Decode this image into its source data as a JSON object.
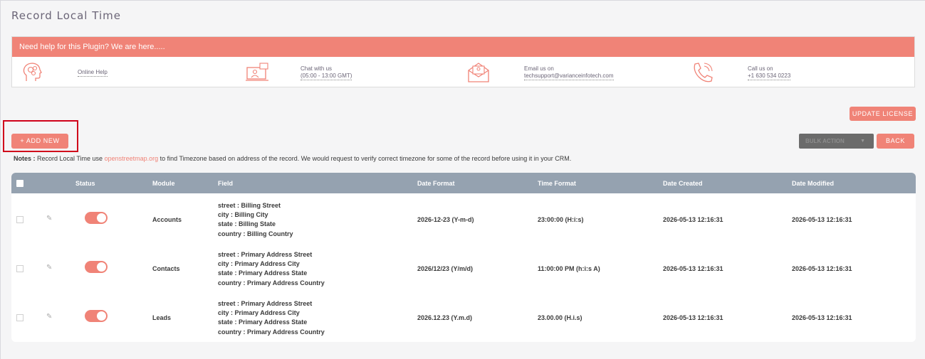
{
  "page": {
    "title": "Record Local Time"
  },
  "help": {
    "banner": "Need help for this Plugin? We are here.....",
    "items": [
      {
        "icon": "brain-head-icon",
        "lines": [
          "Online Help"
        ]
      },
      {
        "icon": "monitor-chat-icon",
        "lines": [
          "Chat with us",
          "(05:00 - 13:00 GMT)"
        ]
      },
      {
        "icon": "envelope-icon",
        "lines": [
          "Email us on",
          "techsupport@varianceinfotech.com"
        ]
      },
      {
        "icon": "phone-icon",
        "lines": [
          "Call us on",
          "+1 630 534 0223"
        ]
      }
    ]
  },
  "toolbar": {
    "update_license": "UPDATE LICENSE",
    "add_new": "+ ADD NEW",
    "bulk_action": "BULK ACTION",
    "back": "BACK"
  },
  "notes": {
    "label": "Notes :",
    "prefix": " Record Local Time use ",
    "link": "openstreetmap.org",
    "suffix": " to find Timezone based on address of the record. We would request to verify correct timezone for some of the record before using it in your CRM."
  },
  "table": {
    "headers": [
      "Status",
      "Module",
      "Field",
      "Date Format",
      "Time Format",
      "Date Created",
      "Date Modified"
    ],
    "rows": [
      {
        "module": "Accounts",
        "fields": [
          {
            "key": "street",
            "val": "Billing Street"
          },
          {
            "key": "city",
            "val": "Billing City"
          },
          {
            "key": "state",
            "val": "Billing State"
          },
          {
            "key": "country",
            "val": "Billing Country"
          }
        ],
        "date_format": "2026-12-23 (Y-m-d)",
        "time_format": "23:00:00 (H:i:s)",
        "date_created": "2026-05-13 12:16:31",
        "date_modified": "2026-05-13 12:16:31"
      },
      {
        "module": "Contacts",
        "fields": [
          {
            "key": "street",
            "val": "Primary Address Street"
          },
          {
            "key": "city",
            "val": "Primary Address City"
          },
          {
            "key": "state",
            "val": "Primary Address State"
          },
          {
            "key": "country",
            "val": "Primary Address Country"
          }
        ],
        "date_format": "2026/12/23 (Y/m/d)",
        "time_format": "11:00:00 PM (h:i:s A)",
        "date_created": "2026-05-13 12:16:31",
        "date_modified": "2026-05-13 12:16:31"
      },
      {
        "module": "Leads",
        "fields": [
          {
            "key": "street",
            "val": "Primary Address Street"
          },
          {
            "key": "city",
            "val": "Primary Address City"
          },
          {
            "key": "state",
            "val": "Primary Address State"
          },
          {
            "key": "country",
            "val": "Primary Address Country"
          }
        ],
        "date_format": "2026.12.23 (Y.m.d)",
        "time_format": "23.00.00 (H.i.s)",
        "date_created": "2026-05-13 12:16:31",
        "date_modified": "2026-05-13 12:16:31"
      }
    ]
  }
}
